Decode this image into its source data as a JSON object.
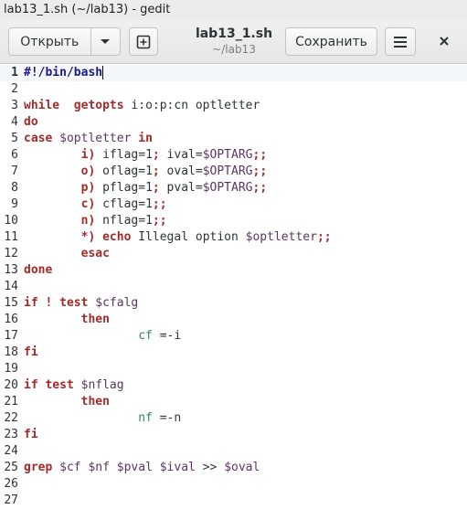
{
  "window": {
    "title": "lab13_1.sh (~/lab13) - gedit"
  },
  "toolbar": {
    "open_label": "Открыть",
    "save_label": "Сохранить",
    "doc_title": "lab13_1.sh",
    "doc_subtitle": "~/lab13"
  },
  "icons": {
    "open_menu": "chevron-down-icon",
    "new_tab": "new-tab-icon",
    "menu": "hamburger-menu-icon",
    "close": "close-icon"
  },
  "editor": {
    "lines": [
      {
        "n": "1",
        "tokens": [
          [
            "b",
            "#!/bin/bash"
          ]
        ]
      },
      {
        "n": "2",
        "tokens": []
      },
      {
        "n": "3",
        "tokens": [
          [
            "k",
            "while"
          ],
          [
            "",
            "  "
          ],
          [
            "k",
            "getopts"
          ],
          [
            "",
            " i:o:p:cn optletter"
          ]
        ]
      },
      {
        "n": "4",
        "tokens": [
          [
            "k",
            "do"
          ]
        ]
      },
      {
        "n": "5",
        "tokens": [
          [
            "k",
            "case"
          ],
          [
            "",
            " "
          ],
          [
            "v",
            "$optletter"
          ],
          [
            "",
            " "
          ],
          [
            "k",
            "in"
          ]
        ]
      },
      {
        "n": "6",
        "tokens": [
          [
            "",
            "        "
          ],
          [
            "k",
            "i)"
          ],
          [
            "",
            " iflag=1"
          ],
          [
            "k",
            ";"
          ],
          [
            "",
            " ival="
          ],
          [
            "v",
            "$OPTARG"
          ],
          [
            "k",
            ";;"
          ]
        ]
      },
      {
        "n": "7",
        "tokens": [
          [
            "",
            "        "
          ],
          [
            "k",
            "o)"
          ],
          [
            "",
            " oflag=1"
          ],
          [
            "k",
            ";"
          ],
          [
            "",
            " oval="
          ],
          [
            "v",
            "$OPTARG"
          ],
          [
            "k",
            ";;"
          ]
        ]
      },
      {
        "n": "8",
        "tokens": [
          [
            "",
            "        "
          ],
          [
            "k",
            "p)"
          ],
          [
            "",
            " pflag=1"
          ],
          [
            "k",
            ";"
          ],
          [
            "",
            " pval="
          ],
          [
            "v",
            "$OPTARG"
          ],
          [
            "k",
            ";;"
          ]
        ]
      },
      {
        "n": "9",
        "tokens": [
          [
            "",
            "        "
          ],
          [
            "k",
            "c)"
          ],
          [
            "",
            " cflag=1"
          ],
          [
            "k",
            ";;"
          ]
        ]
      },
      {
        "n": "10",
        "tokens": [
          [
            "",
            "        "
          ],
          [
            "k",
            "n)"
          ],
          [
            "",
            " nflag=1"
          ],
          [
            "k",
            ";;"
          ]
        ]
      },
      {
        "n": "11",
        "tokens": [
          [
            "",
            "        "
          ],
          [
            "k",
            "*)"
          ],
          [
            "",
            " "
          ],
          [
            "k",
            "echo"
          ],
          [
            "",
            " Illegal option "
          ],
          [
            "v",
            "$optletter"
          ],
          [
            "k",
            ";;"
          ]
        ]
      },
      {
        "n": "12",
        "tokens": [
          [
            "",
            "        "
          ],
          [
            "k",
            "esac"
          ]
        ]
      },
      {
        "n": "13",
        "tokens": [
          [
            "k",
            "done"
          ]
        ]
      },
      {
        "n": "14",
        "tokens": []
      },
      {
        "n": "15",
        "tokens": [
          [
            "k",
            "if"
          ],
          [
            "",
            " "
          ],
          [
            "k",
            "!"
          ],
          [
            "",
            " "
          ],
          [
            "k",
            "test"
          ],
          [
            "",
            " "
          ],
          [
            "v",
            "$cfalg"
          ]
        ]
      },
      {
        "n": "16",
        "tokens": [
          [
            "",
            "        "
          ],
          [
            "k",
            "then"
          ]
        ]
      },
      {
        "n": "17",
        "tokens": [
          [
            "",
            "                "
          ],
          [
            "g",
            "cf"
          ],
          [
            "",
            " =-i"
          ]
        ]
      },
      {
        "n": "18",
        "tokens": [
          [
            "k",
            "fi"
          ]
        ]
      },
      {
        "n": "19",
        "tokens": []
      },
      {
        "n": "20",
        "tokens": [
          [
            "k",
            "if"
          ],
          [
            "",
            " "
          ],
          [
            "k",
            "test"
          ],
          [
            "",
            " "
          ],
          [
            "v",
            "$nflag"
          ]
        ]
      },
      {
        "n": "21",
        "tokens": [
          [
            "",
            "        "
          ],
          [
            "k",
            "then"
          ]
        ]
      },
      {
        "n": "22",
        "tokens": [
          [
            "",
            "                "
          ],
          [
            "g",
            "nf"
          ],
          [
            "",
            " =-n"
          ]
        ]
      },
      {
        "n": "23",
        "tokens": [
          [
            "k",
            "fi"
          ]
        ]
      },
      {
        "n": "24",
        "tokens": []
      },
      {
        "n": "25",
        "tokens": [
          [
            "k",
            "grep"
          ],
          [
            "",
            " "
          ],
          [
            "v",
            "$cf"
          ],
          [
            "",
            " "
          ],
          [
            "v",
            "$nf"
          ],
          [
            "",
            " "
          ],
          [
            "v",
            "$pval"
          ],
          [
            "",
            " "
          ],
          [
            "v",
            "$ival"
          ],
          [
            "",
            " >> "
          ],
          [
            "v",
            "$oval"
          ]
        ]
      },
      {
        "n": "26",
        "tokens": []
      },
      {
        "n": "27",
        "tokens": []
      }
    ]
  }
}
